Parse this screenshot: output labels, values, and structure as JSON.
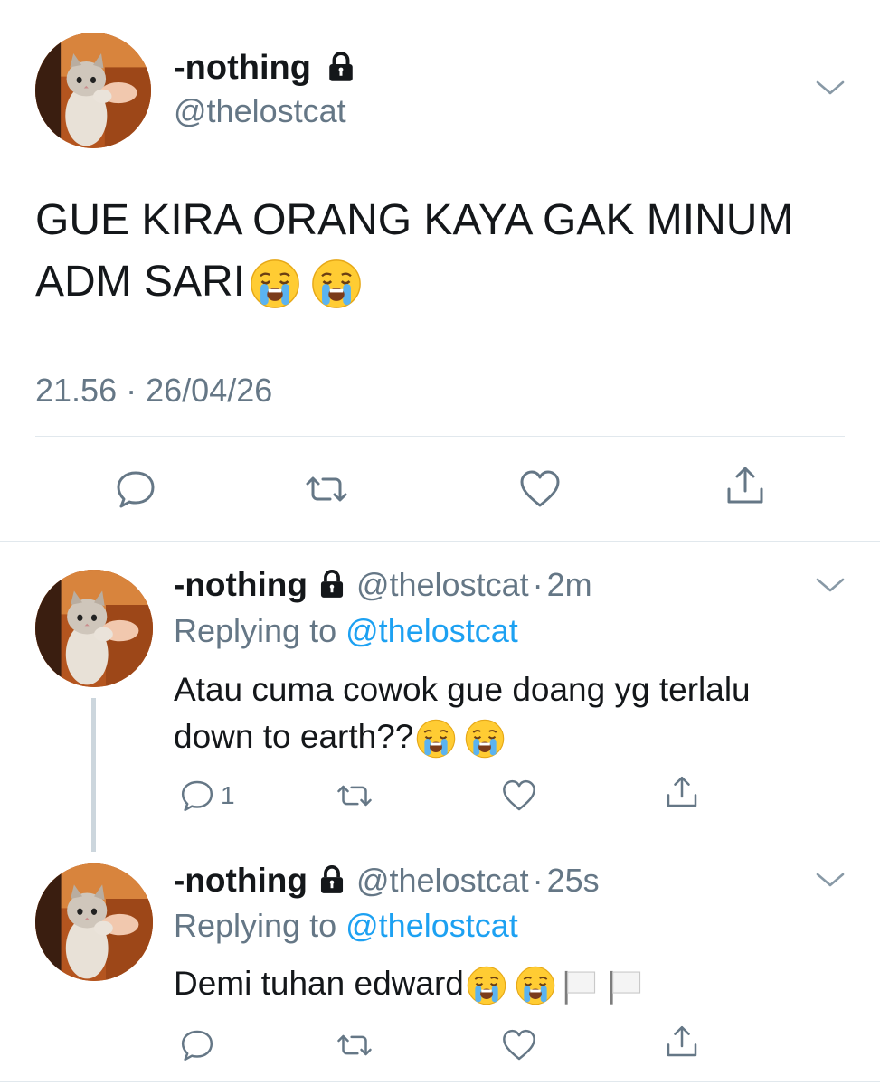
{
  "main_tweet": {
    "display_name": "-nothing",
    "handle": "@thelostcat",
    "text": "GUE KIRA ORANG KAYA GAK MINUM ADM SARI",
    "time": "21.56",
    "separator": "·",
    "date": "26/04/26"
  },
  "replies": [
    {
      "display_name": "-nothing",
      "handle": "@thelostcat",
      "separator": "·",
      "age": "2m",
      "replying_prefix": "Replying to",
      "replying_handle": "@thelostcat",
      "text": "Atau cuma cowok gue doang yg terlalu down to earth??",
      "reply_count": "1"
    },
    {
      "display_name": "-nothing",
      "handle": "@thelostcat",
      "separator": "·",
      "age": "25s",
      "replying_prefix": "Replying to",
      "replying_handle": "@thelostcat",
      "text": "Demi tuhan edward",
      "reply_count": ""
    }
  ],
  "icons": {
    "lock": "lock-icon",
    "chevron": "chevron-down-icon",
    "reply": "reply-icon",
    "retweet": "retweet-icon",
    "like": "heart-icon",
    "share": "share-icon",
    "emoji_cry": "loudly-crying-face-emoji",
    "emoji_flag": "white-flag-emoji"
  },
  "colors": {
    "text": "#14171a",
    "muted": "#657786",
    "link": "#1da1f2",
    "divider": "#e1e8ed",
    "thread_line": "#ccd6dd"
  }
}
